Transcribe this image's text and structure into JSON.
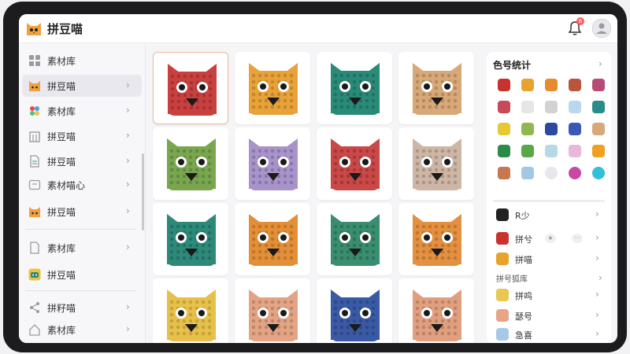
{
  "app": {
    "title": "拼豆喵"
  },
  "header": {
    "notification_count": "6"
  },
  "sidebar": {
    "items": [
      {
        "label": "素材库",
        "icon": "grid-icon",
        "active": false
      },
      {
        "label": "拼豆喵",
        "icon": "cat-icon",
        "active": true
      },
      {
        "label": "素材库",
        "icon": "colorful-leaves-icon",
        "active": false
      },
      {
        "label": "拼豆喵",
        "icon": "building-icon",
        "active": false
      },
      {
        "label": "拼豆喵",
        "icon": "document-icon",
        "active": false
      },
      {
        "label": "素材喵心",
        "icon": "card-icon",
        "active": false
      },
      {
        "label": "拼豆喵",
        "icon": "cat-icon",
        "active": false
      },
      {
        "label": "素材库",
        "icon": "folder-icon",
        "active": false
      },
      {
        "label": "拼豆喵",
        "icon": "cat-app-icon",
        "active": false
      },
      {
        "label": "拼籽喵",
        "icon": "share-icon",
        "active": false
      },
      {
        "label": "素材库",
        "icon": "home-icon",
        "active": false
      }
    ]
  },
  "tiles": [
    {
      "name": "red-cat",
      "color": "#c9413f",
      "dark": "#8a2727"
    },
    {
      "name": "orange-cat",
      "color": "#e8a23a",
      "dark": "#a86b1c"
    },
    {
      "name": "teal-cat",
      "color": "#2a8a78",
      "dark": "#1a5c50"
    },
    {
      "name": "tan-cat",
      "color": "#d7a878",
      "dark": "#9a7049"
    },
    {
      "name": "green-cat",
      "color": "#7aa650",
      "dark": "#4f7430"
    },
    {
      "name": "lavender-cat",
      "color": "#a894c8",
      "dark": "#6f5f92"
    },
    {
      "name": "red-cat-2",
      "color": "#c94848",
      "dark": "#8a2a2a"
    },
    {
      "name": "beige-cat",
      "color": "#cdb6a6",
      "dark": "#8e7868"
    },
    {
      "name": "teal-cat-2",
      "color": "#2d8a7a",
      "dark": "#1b5b50"
    },
    {
      "name": "orange-cat-2",
      "color": "#e38f38",
      "dark": "#a2601c"
    },
    {
      "name": "teal-cat-3",
      "color": "#3a8e70",
      "dark": "#245c48"
    },
    {
      "name": "orange-cat-3",
      "color": "#e39040",
      "dark": "#a26020"
    },
    {
      "name": "yellow-cat",
      "color": "#e6c04a",
      "dark": "#a6882a"
    },
    {
      "name": "peach-cat",
      "color": "#e2a484",
      "dark": "#a26c52"
    },
    {
      "name": "navy-cat",
      "color": "#3a5aa6",
      "dark": "#243a70"
    },
    {
      "name": "salmon-cat",
      "color": "#e0a080",
      "dark": "#a06a4c"
    }
  ],
  "palette": {
    "title": "色号统计",
    "colors": [
      "#c8322e",
      "#e8a22e",
      "#e88a2e",
      "#b8553a",
      "#b84a78",
      "#c84a58",
      "#e6e6e6",
      "#d2d2d2",
      "#b8d8f0",
      "#2a8c8a",
      "#e8c832",
      "#90b850",
      "#2a4aa0",
      "#3a58b8",
      "#d8a878",
      "#2a8c48",
      "#58a848",
      "#b8d8e8",
      "#e8b8d8",
      "#f0a020",
      "#c87850",
      "#a0c8e8",
      "#e8e8ec",
      "#c848a8",
      "#30c0d8"
    ]
  },
  "bead_list": {
    "top": [
      {
        "label": "R少",
        "color": "#222222"
      },
      {
        "label": "拼兮",
        "color": "#c8322e"
      },
      {
        "label": "拼喵",
        "color": "#e8a22e"
      }
    ],
    "section_label": "拼号狐库",
    "bottom": [
      {
        "label": "拼呜",
        "color": "#e8c850"
      },
      {
        "label": "瑟号",
        "color": "#e8a484"
      },
      {
        "label": "急喜",
        "color": "#a8c8e8"
      }
    ]
  }
}
